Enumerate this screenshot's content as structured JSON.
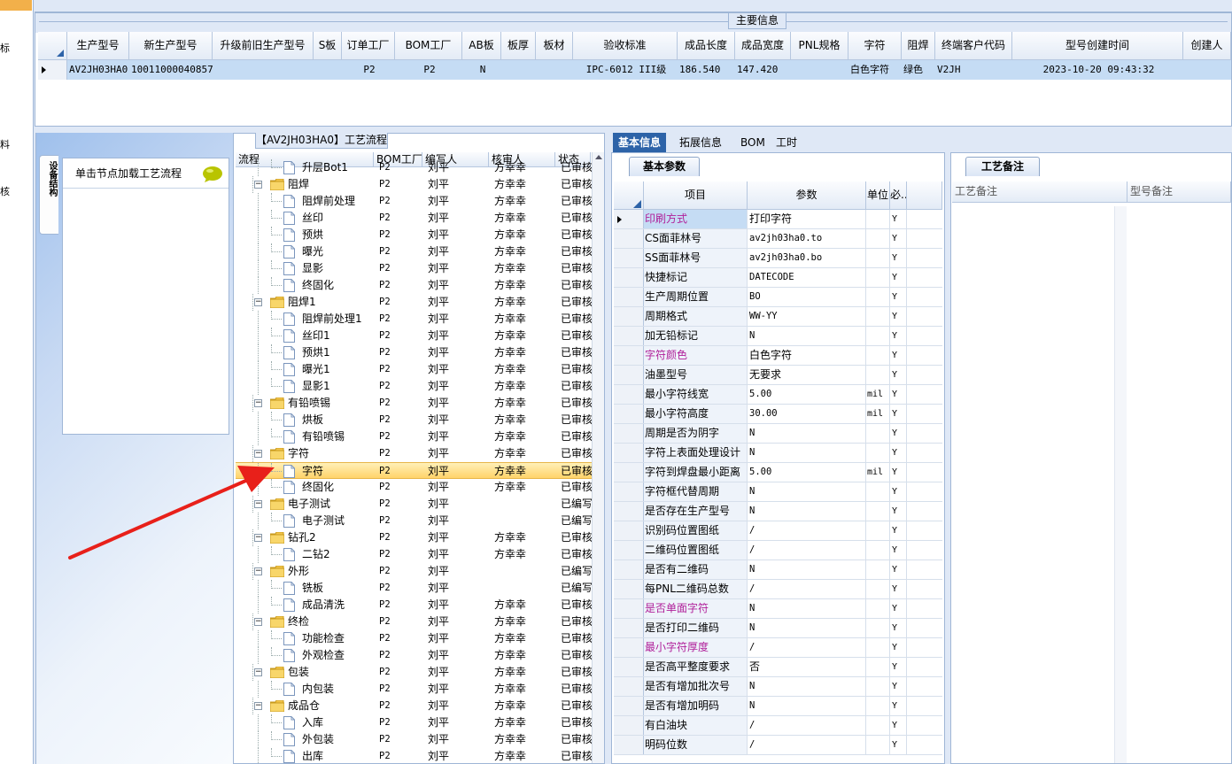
{
  "left_strip": {
    "labels": [
      "标",
      "料",
      "核"
    ]
  },
  "main_info": {
    "caption": "主要信息",
    "headers": [
      "生产型号",
      "新生产型号",
      "升级前旧生产型号",
      "S板",
      "订单工厂",
      "BOM工厂",
      "AB板",
      "板厚",
      "板材",
      "验收标准",
      "成品长度",
      "成品宽度",
      "PNL规格",
      "字符",
      "阻焊",
      "终端客户代码",
      "型号创建时间",
      "创建人"
    ],
    "row": [
      "AV2JH03HA0",
      "10011000040857",
      "",
      "",
      "P2",
      "P2",
      "N",
      "",
      "",
      "IPC-6012 III级",
      "186.540",
      "147.420",
      "",
      "白色字符",
      "绿色",
      "V2JH",
      "2023-10-20 09:43:32",
      ""
    ]
  },
  "left_panel": {
    "side_tab": "设备结构",
    "node_header": "单击节点加载工艺流程"
  },
  "process": {
    "caption": "【AV2JH03HA0】工艺流程",
    "headers": [
      "流程",
      "BOM工厂",
      "编写人",
      "核审人",
      "状态"
    ],
    "rows": [
      {
        "level": 1,
        "name": "升层Bot1",
        "fac": "P2",
        "wr": "刘平",
        "rv": "方幸幸",
        "st": "已审核"
      },
      {
        "level": 0,
        "name": "阻焊",
        "fac": "P2",
        "wr": "刘平",
        "rv": "方幸幸",
        "st": "已审核"
      },
      {
        "level": 1,
        "name": "阻焊前处理",
        "fac": "P2",
        "wr": "刘平",
        "rv": "方幸幸",
        "st": "已审核"
      },
      {
        "level": 1,
        "name": "丝印",
        "fac": "P2",
        "wr": "刘平",
        "rv": "方幸幸",
        "st": "已审核"
      },
      {
        "level": 1,
        "name": "预烘",
        "fac": "P2",
        "wr": "刘平",
        "rv": "方幸幸",
        "st": "已审核"
      },
      {
        "level": 1,
        "name": "曝光",
        "fac": "P2",
        "wr": "刘平",
        "rv": "方幸幸",
        "st": "已审核"
      },
      {
        "level": 1,
        "name": "显影",
        "fac": "P2",
        "wr": "刘平",
        "rv": "方幸幸",
        "st": "已审核"
      },
      {
        "level": 1,
        "name": "终固化",
        "fac": "P2",
        "wr": "刘平",
        "rv": "方幸幸",
        "st": "已审核"
      },
      {
        "level": 0,
        "name": "阻焊1",
        "fac": "P2",
        "wr": "刘平",
        "rv": "方幸幸",
        "st": "已审核"
      },
      {
        "level": 1,
        "name": "阻焊前处理1",
        "fac": "P2",
        "wr": "刘平",
        "rv": "方幸幸",
        "st": "已审核"
      },
      {
        "level": 1,
        "name": "丝印1",
        "fac": "P2",
        "wr": "刘平",
        "rv": "方幸幸",
        "st": "已审核"
      },
      {
        "level": 1,
        "name": "预烘1",
        "fac": "P2",
        "wr": "刘平",
        "rv": "方幸幸",
        "st": "已审核"
      },
      {
        "level": 1,
        "name": "曝光1",
        "fac": "P2",
        "wr": "刘平",
        "rv": "方幸幸",
        "st": "已审核"
      },
      {
        "level": 1,
        "name": "显影1",
        "fac": "P2",
        "wr": "刘平",
        "rv": "方幸幸",
        "st": "已审核"
      },
      {
        "level": 0,
        "name": "有铅喷锡",
        "fac": "P2",
        "wr": "刘平",
        "rv": "方幸幸",
        "st": "已审核"
      },
      {
        "level": 1,
        "name": "烘板",
        "fac": "P2",
        "wr": "刘平",
        "rv": "方幸幸",
        "st": "已审核"
      },
      {
        "level": 1,
        "name": "有铅喷锡",
        "fac": "P2",
        "wr": "刘平",
        "rv": "方幸幸",
        "st": "已审核"
      },
      {
        "level": 0,
        "name": "字符",
        "fac": "P2",
        "wr": "刘平",
        "rv": "方幸幸",
        "st": "已审核"
      },
      {
        "level": 1,
        "name": "字符",
        "fac": "P2",
        "wr": "刘平",
        "rv": "方幸幸",
        "st": "已审核",
        "selected": true
      },
      {
        "level": 1,
        "name": "终固化",
        "fac": "P2",
        "wr": "刘平",
        "rv": "方幸幸",
        "st": "已审核"
      },
      {
        "level": 0,
        "name": "电子测试",
        "fac": "P2",
        "wr": "刘平",
        "rv": "",
        "st": "已编写"
      },
      {
        "level": 1,
        "name": "电子测试",
        "fac": "P2",
        "wr": "刘平",
        "rv": "",
        "st": "已编写"
      },
      {
        "level": 0,
        "name": "钻孔2",
        "fac": "P2",
        "wr": "刘平",
        "rv": "方幸幸",
        "st": "已审核"
      },
      {
        "level": 1,
        "name": "二钻2",
        "fac": "P2",
        "wr": "刘平",
        "rv": "方幸幸",
        "st": "已审核"
      },
      {
        "level": 0,
        "name": "外形",
        "fac": "P2",
        "wr": "刘平",
        "rv": "",
        "st": "已编写"
      },
      {
        "level": 1,
        "name": "铣板",
        "fac": "P2",
        "wr": "刘平",
        "rv": "",
        "st": "已编写"
      },
      {
        "level": 1,
        "name": "成品清洗",
        "fac": "P2",
        "wr": "刘平",
        "rv": "方幸幸",
        "st": "已审核"
      },
      {
        "level": 0,
        "name": "终检",
        "fac": "P2",
        "wr": "刘平",
        "rv": "方幸幸",
        "st": "已审核"
      },
      {
        "level": 1,
        "name": "功能检查",
        "fac": "P2",
        "wr": "刘平",
        "rv": "方幸幸",
        "st": "已审核"
      },
      {
        "level": 1,
        "name": "外观检查",
        "fac": "P2",
        "wr": "刘平",
        "rv": "方幸幸",
        "st": "已审核"
      },
      {
        "level": 0,
        "name": "包装",
        "fac": "P2",
        "wr": "刘平",
        "rv": "方幸幸",
        "st": "已审核"
      },
      {
        "level": 1,
        "name": "内包装",
        "fac": "P2",
        "wr": "刘平",
        "rv": "方幸幸",
        "st": "已审核"
      },
      {
        "level": 0,
        "name": "成品仓",
        "fac": "P2",
        "wr": "刘平",
        "rv": "方幸幸",
        "st": "已审核"
      },
      {
        "level": 1,
        "name": "入库",
        "fac": "P2",
        "wr": "刘平",
        "rv": "方幸幸",
        "st": "已审核"
      },
      {
        "level": 1,
        "name": "外包装",
        "fac": "P2",
        "wr": "刘平",
        "rv": "方幸幸",
        "st": "已审核"
      },
      {
        "level": 1,
        "name": "出库",
        "fac": "P2",
        "wr": "刘平",
        "rv": "方幸幸",
        "st": "已审核"
      }
    ]
  },
  "right_tabs": [
    "基本信息",
    "拓展信息",
    "BOM",
    "工时"
  ],
  "basic": {
    "subtab": "基本参数",
    "headers": [
      "项目",
      "参数",
      "单位",
      "必..."
    ],
    "rows": [
      {
        "item": "印刷方式",
        "val": "打印字符",
        "unit": "",
        "y": "Y",
        "hl": true,
        "sel": true
      },
      {
        "item": "CS面菲林号",
        "val": "av2jh03ha0.to",
        "unit": "",
        "y": "Y"
      },
      {
        "item": "SS面菲林号",
        "val": "av2jh03ha0.bo",
        "unit": "",
        "y": "Y"
      },
      {
        "item": "快捷标记",
        "val": "DATECODE",
        "unit": "",
        "y": "Y"
      },
      {
        "item": "生产周期位置",
        "val": "BO",
        "unit": "",
        "y": "Y"
      },
      {
        "item": "周期格式",
        "val": "WW-YY",
        "unit": "",
        "y": "Y"
      },
      {
        "item": "加无铅标记",
        "val": "N",
        "unit": "",
        "y": "Y"
      },
      {
        "item": "字符颜色",
        "val": "白色字符",
        "unit": "",
        "y": "Y",
        "hl": true
      },
      {
        "item": "油墨型号",
        "val": "无要求",
        "unit": "",
        "y": "Y"
      },
      {
        "item": "最小字符线宽",
        "val": "5.00",
        "unit": "mil",
        "y": "Y"
      },
      {
        "item": "最小字符高度",
        "val": "30.00",
        "unit": "mil",
        "y": "Y"
      },
      {
        "item": "周期是否为阴字",
        "val": "N",
        "unit": "",
        "y": "Y"
      },
      {
        "item": "字符上表面处理设计",
        "val": "N",
        "unit": "",
        "y": "Y"
      },
      {
        "item": "字符到焊盘最小距离",
        "val": "5.00",
        "unit": "mil",
        "y": "Y"
      },
      {
        "item": "字符框代替周期",
        "val": "N",
        "unit": "",
        "y": "Y"
      },
      {
        "item": "是否存在生产型号",
        "val": "N",
        "unit": "",
        "y": "Y"
      },
      {
        "item": "识别码位置图纸",
        "val": "/",
        "unit": "",
        "y": "Y"
      },
      {
        "item": "二维码位置图纸",
        "val": "/",
        "unit": "",
        "y": "Y"
      },
      {
        "item": "是否有二维码",
        "val": "N",
        "unit": "",
        "y": "Y"
      },
      {
        "item": "每PNL二维码总数",
        "val": "/",
        "unit": "",
        "y": "Y"
      },
      {
        "item": "是否单面字符",
        "val": "N",
        "unit": "",
        "y": "Y",
        "hl": true
      },
      {
        "item": "是否打印二维码",
        "val": "N",
        "unit": "",
        "y": "Y"
      },
      {
        "item": "最小字符厚度",
        "val": "/",
        "unit": "",
        "y": "Y",
        "hl": true
      },
      {
        "item": "是否高平整度要求",
        "val": "否",
        "unit": "",
        "y": "Y"
      },
      {
        "item": "是否有增加批次号",
        "val": "N",
        "unit": "",
        "y": "Y"
      },
      {
        "item": "是否有增加明码",
        "val": "N",
        "unit": "",
        "y": "Y"
      },
      {
        "item": "有白油块",
        "val": "/",
        "unit": "",
        "y": "Y"
      },
      {
        "item": "明码位数",
        "val": "/",
        "unit": "",
        "y": "Y"
      }
    ]
  },
  "notes": {
    "subtab": "工艺备注",
    "col1": "工艺备注",
    "col2": "型号备注"
  },
  "colors": {
    "accent": "#2d63a8",
    "highlight_text": "#b0209a",
    "arrow": "#e8201a"
  }
}
